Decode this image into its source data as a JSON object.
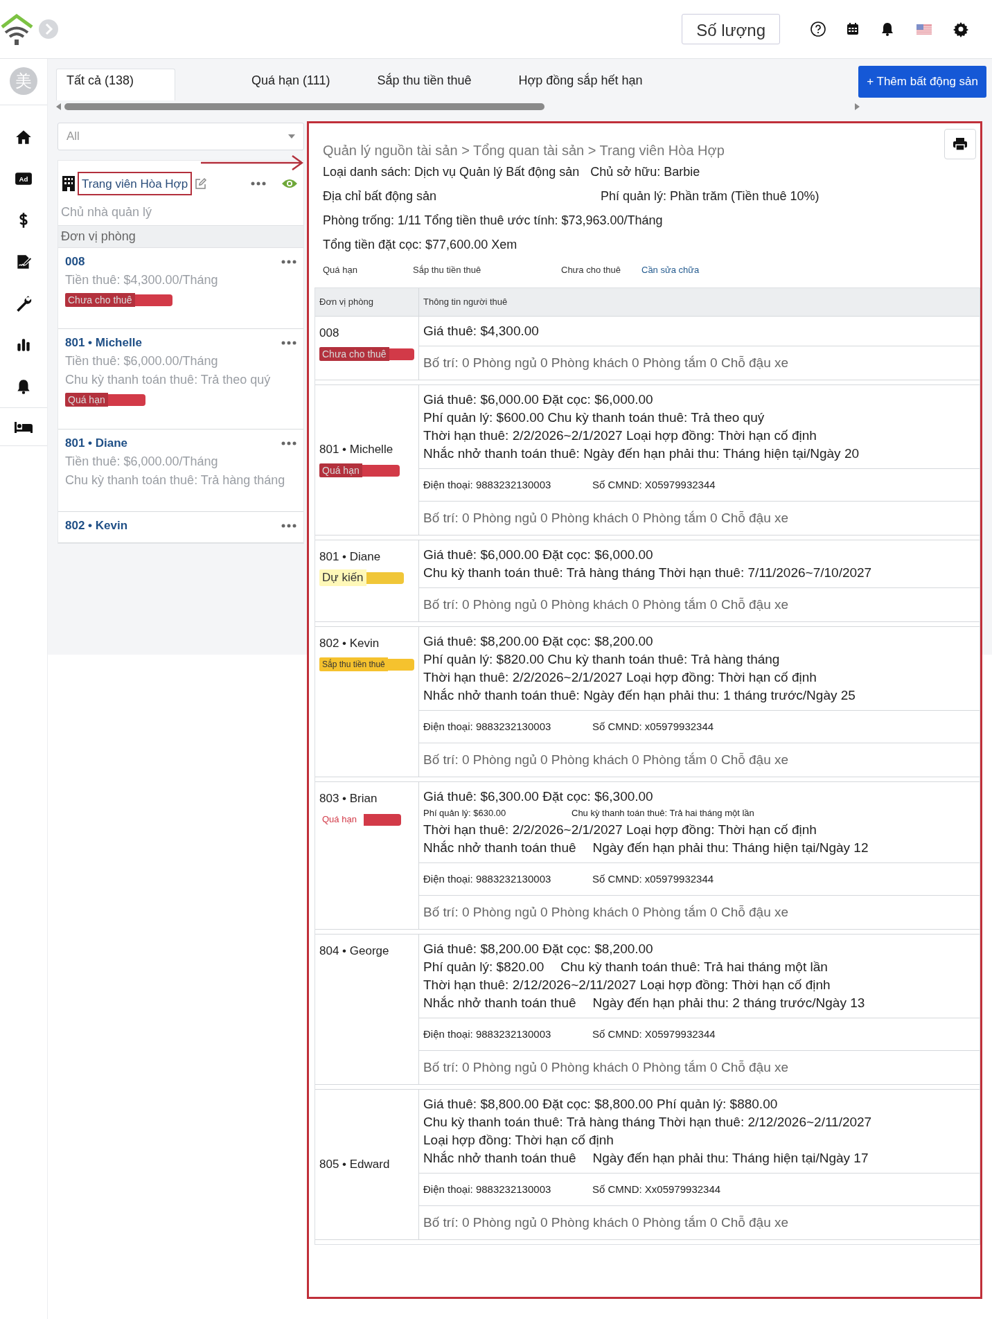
{
  "top_bar": {
    "quantity_button": "Số lượng"
  },
  "avatar": {
    "initial": "美"
  },
  "nav": {
    "ad_icon_text": "Ad"
  },
  "tabs": [
    {
      "label": "Tất cả (138)",
      "selected": true
    },
    {
      "label": "Quá hạn (111)",
      "selected": false
    },
    {
      "label": "Sắp thu tiền thuê",
      "selected": false
    },
    {
      "label": "Hợp đồng sắp hết hạn",
      "selected": false
    }
  ],
  "add_button": "+ Thêm bất động sản",
  "filter": {
    "value": "All"
  },
  "property": {
    "name": "Trang viên Hòa Hợp",
    "subtitle": "Chủ nhà quản lý",
    "section": "Đơn vị phòng"
  },
  "units": [
    {
      "title": "008",
      "lines": [
        "Tiền thuê: $4,300.00/Tháng"
      ],
      "status": {
        "label": "Chưa cho thuê",
        "kind": "solid",
        "color": "#d23a48"
      }
    },
    {
      "title": "801 • Michelle",
      "lines": [
        "Tiền thuê: $6,000.00/Tháng",
        "Chu kỳ thanh toán thuê: Trả theo quý"
      ],
      "status": {
        "label": "Quá hạn",
        "kind": "solid",
        "color": "#d23a48"
      }
    },
    {
      "title": "801 • Diane",
      "lines": [
        "Tiền thuê: $6,000.00/Tháng",
        "Chu kỳ thanh toán thuê: Trả hàng tháng"
      ]
    },
    {
      "title": "802 • Kevin"
    }
  ],
  "detail": {
    "breadcrumb": "Quản lý nguồn tài sản > Tổng quan tài sản > Trang viên Hòa Hợp",
    "info": [
      {
        "kind": "inline",
        "parts": [
          "Loại danh sách: Dịch vụ Quản lý Bất động sản",
          "Chủ sở hữu: Barbie"
        ]
      },
      {
        "kind": "pair",
        "parts": [
          "Địa chỉ bất động sản",
          "Phí quản lý: Phần trăm (Tiền thuê 10%)"
        ]
      },
      {
        "kind": "inline",
        "parts": [
          "Phòng trống: 1/11 Tổng tiền thuê ước tính: $73,963.00/Tháng"
        ]
      },
      {
        "kind": "inline",
        "parts": [
          "Tổng tiền đặt cọc: $77,600.00 Xem"
        ]
      }
    ],
    "legend": [
      {
        "label": "Quá hạn",
        "kind": "label"
      },
      {
        "label": "Sắp thu tiền thuê",
        "kind": "label"
      },
      {
        "label": "Chưa cho thuê",
        "kind": "label"
      },
      {
        "label": "Cần sửa chữa",
        "kind": "link"
      }
    ],
    "columns": [
      "Đơn vị phòng",
      "Thông tin người thuê"
    ],
    "rows": [
      {
        "unit": "008",
        "status": {
          "label": "Chưa cho thuê",
          "kind": "solid",
          "color": "#d23a48"
        },
        "sections": [
          [
            {
              "kind": "main",
              "parts": [
                "Giá thuê: $4,300.00"
              ]
            }
          ],
          [
            {
              "kind": "muted",
              "parts": [
                "Bố trí: 0 Phòng ngủ 0 Phòng khách 0 Phòng tắm 0 Chỗ đậu xe"
              ]
            }
          ]
        ]
      },
      {
        "unit": "801 • Michelle",
        "status": {
          "label": "Quá hạn",
          "kind": "solid",
          "color": "#d23a48"
        },
        "sections": [
          [
            {
              "kind": "main",
              "parts": [
                "Giá thuê: $6,000.00 Đặt cọc: $6,000.00"
              ]
            },
            {
              "kind": "main",
              "parts": [
                "Phí quản lý: $600.00 Chu kỳ thanh toán thuê: Trả theo quý"
              ]
            },
            {
              "kind": "main",
              "parts": [
                "Thời hạn thuê: 2/2/2026~2/1/2027 Loại hợp đồng: Thời hạn cố định"
              ]
            },
            {
              "kind": "main",
              "parts": [
                "Nhắc nhở thanh toán thuê: Ngày đến hạn phải thu: Tháng hiện tại/Ngày 20"
              ]
            }
          ],
          [
            {
              "kind": "phone",
              "parts": [
                "Điện thoại: 9883232130003",
                "Số CMND: X05979932344"
              ]
            }
          ],
          [
            {
              "kind": "muted",
              "parts": [
                "Bố trí: 0 Phòng ngủ 0 Phòng khách 0 Phòng tắm 0 Chỗ đậu xe"
              ]
            }
          ]
        ]
      },
      {
        "unit": "801 • Diane",
        "status": {
          "label": "Dự kiến",
          "kind": "pale",
          "color": "#f0c638"
        },
        "sections": [
          [
            {
              "kind": "main",
              "parts": [
                "Giá thuê: $6,000.00 Đặt cọc: $6,000.00"
              ]
            },
            {
              "kind": "main",
              "parts": [
                "Chu kỳ thanh toán thuê: Trả hàng tháng Thời hạn thuê: 7/11/2026~7/10/2027"
              ]
            }
          ],
          [
            {
              "kind": "muted",
              "parts": [
                "Bố trí: 0 Phòng ngủ 0 Phòng khách 0 Phòng tắm 0 Chỗ đậu xe"
              ]
            }
          ]
        ]
      },
      {
        "unit": "802 • Kevin",
        "status": {
          "label": "Sắp thu tiền thuê",
          "kind": "overlay",
          "color": "#f5c22e"
        },
        "sections": [
          [
            {
              "kind": "main",
              "parts": [
                "Giá thuê: $8,200.00  Đặt cọc: $8,200.00"
              ]
            },
            {
              "kind": "main",
              "parts": [
                "Phí quản lý: $820.00 Chu kỳ thanh toán thuê: Trả hàng tháng"
              ]
            },
            {
              "kind": "main",
              "parts": [
                "Thời hạn thuê: 2/2/2026~2/1/2027 Loại hợp đồng: Thời hạn cố định"
              ]
            },
            {
              "kind": "main",
              "parts": [
                "Nhắc nhở thanh toán thuê: Ngày đến hạn phải thu: 1 tháng trước/Ngày 25"
              ]
            }
          ],
          [
            {
              "kind": "phone",
              "parts": [
                "Điện thoại: 9883232130003",
                "Số CMND: x05979932344"
              ]
            }
          ],
          [
            {
              "kind": "muted",
              "parts": [
                "Bố trí: 0 Phòng ngủ 0 Phòng khách 0 Phòng tắm 0 Chỗ đậu xe"
              ]
            }
          ]
        ]
      },
      {
        "unit": "803 • Brian",
        "status": {
          "label": "Quá hạn",
          "kind": "plain",
          "color": "#d23a48"
        },
        "sections": [
          [
            {
              "kind": "main",
              "parts": [
                "Giá thuê: $6,300.00 Đặt cọc: $6,300.00"
              ]
            },
            {
              "kind": "small",
              "parts": [
                "Phí quản lý: $630.00",
                "Chu kỳ thanh toán thuê: Trả hai tháng một lần"
              ]
            },
            {
              "kind": "main",
              "parts": [
                "Thời hạn thuê: 2/2/2026~2/1/2027 Loại hợp đồng: Thời hạn cố định"
              ]
            },
            {
              "kind": "main",
              "parts": [
                "Nhắc nhở thanh toán thuê",
                "Ngày đến hạn phải thu: Tháng hiện tại/Ngày 12"
              ]
            }
          ],
          [
            {
              "kind": "phone",
              "parts": [
                "Điện thoại: 9883232130003",
                "Số CMND: x05979932344"
              ]
            }
          ],
          [
            {
              "kind": "muted",
              "parts": [
                "Bố trí: 0 Phòng ngủ 0 Phòng khách 0 Phòng tắm 0 Chỗ đậu xe"
              ]
            }
          ]
        ]
      },
      {
        "unit": "804 • George",
        "sections": [
          [
            {
              "kind": "main",
              "parts": [
                "Giá thuê: $8,200.00 Đặt cọc: $8,200.00"
              ]
            },
            {
              "kind": "main",
              "parts": [
                "Phí quản lý: $820.00",
                "Chu kỳ thanh toán thuê: Trả hai tháng một lần"
              ]
            },
            {
              "kind": "main",
              "parts": [
                "Thời hạn thuê: 2/12/2026~2/11/2027 Loại hợp đồng: Thời hạn cố định"
              ]
            },
            {
              "kind": "main",
              "parts": [
                "Nhắc nhở thanh toán thuê",
                "Ngày đến hạn phải thu: 2 tháng trước/Ngày 13"
              ]
            }
          ],
          [
            {
              "kind": "phone",
              "parts": [
                "Điện thoại: 9883232130003",
                "Số CMND: X05979932344"
              ]
            }
          ],
          [
            {
              "kind": "muted",
              "parts": [
                "Bố trí: 0 Phòng ngủ 0 Phòng khách 0 Phòng tắm 0 Chỗ đậu xe"
              ]
            }
          ]
        ]
      },
      {
        "unit": "805 • Edward",
        "sections": [
          [
            {
              "kind": "main",
              "parts": [
                "Giá thuê: $8,800.00 Đặt cọc: $8,800.00 Phí quản lý: $880.00"
              ]
            },
            {
              "kind": "main",
              "parts": [
                "Chu kỳ thanh toán thuê: Trả hàng tháng Thời hạn thuê: 2/12/2026~2/11/2027"
              ]
            },
            {
              "kind": "main",
              "parts": [
                "Loại hợp đồng: Thời hạn cố định"
              ]
            },
            {
              "kind": "main",
              "parts": [
                "Nhắc nhở thanh toán thuê",
                "Ngày đến hạn phải thu: Tháng hiện tại/Ngày 17"
              ]
            }
          ],
          [
            {
              "kind": "phone",
              "parts": [
                "Điện thoại: 9883232130003",
                "Số CMND: Xx05979932344"
              ]
            }
          ],
          [
            {
              "kind": "muted",
              "parts": [
                "Bố trí: 0 Phòng ngủ 0 Phòng khách 0 Phòng tắm 0 Chỗ đậu xe"
              ]
            }
          ]
        ]
      }
    ]
  }
}
